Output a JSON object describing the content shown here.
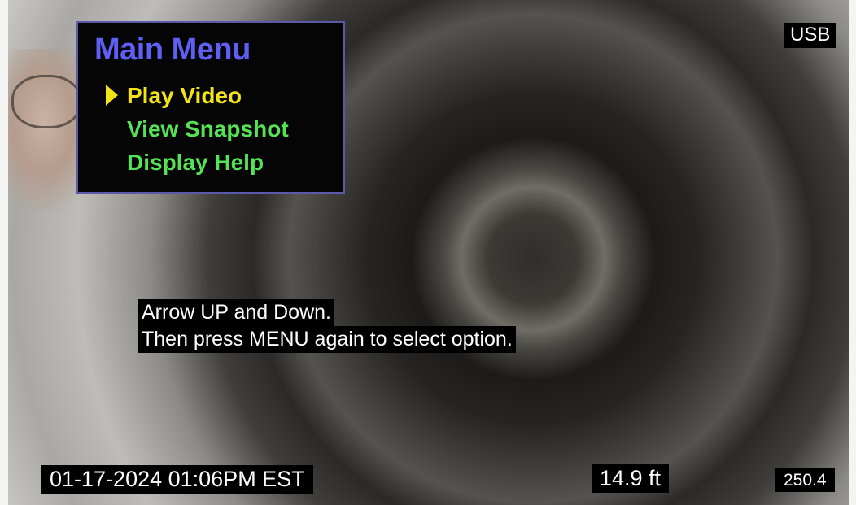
{
  "status": {
    "storage": "USB",
    "datetime": "01-17-2024 01:06PM EST",
    "distance": "14.9 ft",
    "counter": "250.4"
  },
  "menu": {
    "title": "Main Menu",
    "selected_index": 0,
    "cursor_icon": "triangle-right-icon",
    "items": [
      {
        "label": "Play Video"
      },
      {
        "label": "View Snapshot"
      },
      {
        "label": "Display Help"
      }
    ]
  },
  "help": {
    "line1": "Arrow UP and Down.",
    "line2": "Then press MENU again to select option."
  },
  "colors": {
    "menu_title": "#5f5ff5",
    "menu_selected": "#f2e318",
    "menu_item": "#55e255",
    "overlay_bg": "#000000",
    "overlay_text": "#ffffff"
  }
}
